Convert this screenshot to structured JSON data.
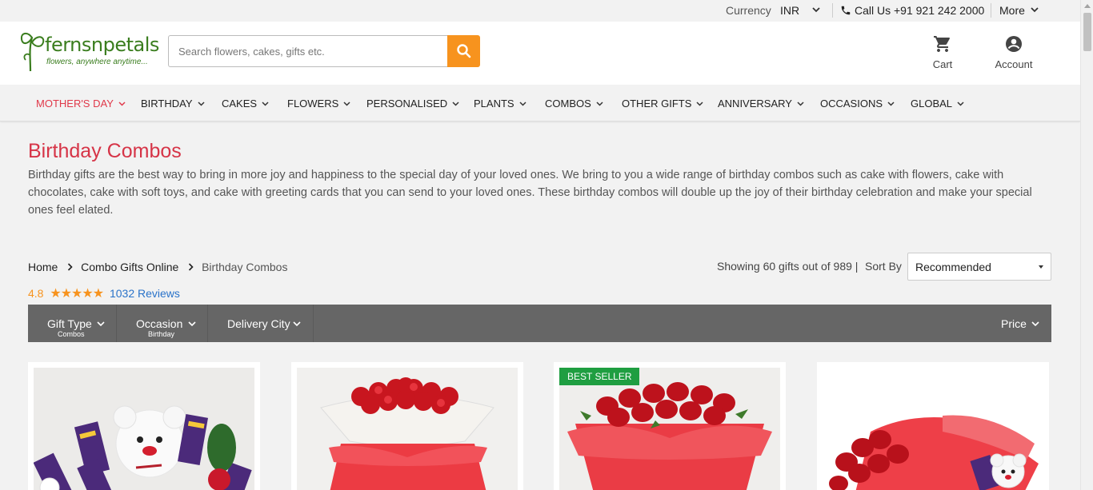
{
  "topbar": {
    "currency_label": "Currency",
    "currency_value": "INR",
    "call_label": "Call Us +91 921 242 2000",
    "more_label": "More"
  },
  "header": {
    "logo_word": "fernsnpetals",
    "logo_tagline": "flowers, anywhere anytime...",
    "search_placeholder": "Search flowers, cakes, gifts etc.",
    "cart_label": "Cart",
    "account_label": "Account"
  },
  "nav": {
    "items": [
      {
        "label": "MOTHER'S DAY"
      },
      {
        "label": "BIRTHDAY"
      },
      {
        "label": "CAKES"
      },
      {
        "label": "FLOWERS"
      },
      {
        "label": "PERSONALISED"
      },
      {
        "label": "PLANTS"
      },
      {
        "label": "COMBOS"
      },
      {
        "label": "OTHER GIFTS"
      },
      {
        "label": "ANNIVERSARY"
      },
      {
        "label": "OCCASIONS"
      },
      {
        "label": "GLOBAL"
      }
    ]
  },
  "page": {
    "title": "Birthday Combos",
    "description": "Birthday gifts are the best way to bring in more joy and happiness to the special day of your loved ones. We bring to you a wide range of birthday combos such as cake with flowers, cake with chocolates, cake with soft toys, and cake with greeting cards that you can send to your loved ones. These birthday combos will double up the joy of their birthday celebration and make your special ones feel elated."
  },
  "breadcrumb": {
    "items": [
      "Home",
      "Combo Gifts Online",
      "Birthday Combos"
    ]
  },
  "rating": {
    "score": "4.8",
    "stars": "★★★★★",
    "reviews_count": "1032",
    "reviews_label": "Reviews"
  },
  "listing": {
    "showing_text": "Showing 60 gifts out of 989 |",
    "sort_label": "Sort By",
    "sort_value": "Recommended"
  },
  "filters": {
    "gift_type_label": "Gift Type",
    "gift_type_value": "Combos",
    "occasion_label": "Occasion",
    "occasion_value": "Birthday",
    "delivery_city_label": "Delivery City",
    "price_label": "Price"
  },
  "products": {
    "badge": "BEST SELLER"
  },
  "colors": {
    "brand_green": "#3a7d1e",
    "accent_orange": "#f7931e",
    "title_red": "#d63447",
    "filter_gray": "#666666",
    "badge_green": "#1f9e41"
  }
}
